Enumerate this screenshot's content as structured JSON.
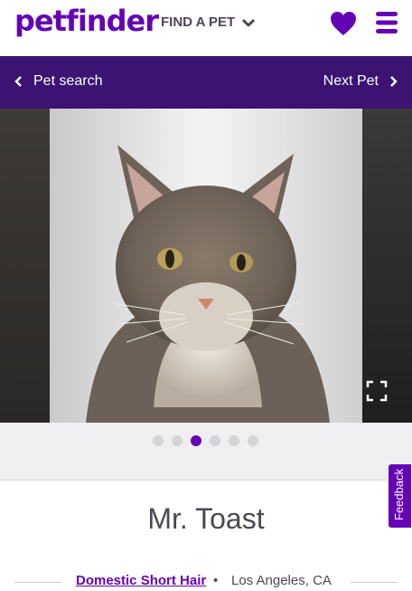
{
  "header": {
    "logo_text": "petfinder",
    "find_a_pet_label": "FIND A PET",
    "brand_color": "#6504b5",
    "icons": {
      "dropdown": "chevron-down-icon",
      "favorites": "heart-icon",
      "menu": "hamburger-menu-icon"
    }
  },
  "nav": {
    "back_label": "Pet search",
    "next_label": "Next Pet",
    "background": "#3a1373"
  },
  "gallery": {
    "total_images": 6,
    "active_index": 3,
    "expand_icon": "fullscreen-icon"
  },
  "pet": {
    "name": "Mr. Toast",
    "breed": "Domestic Short Hair",
    "separator": "•",
    "location": "Los Angeles, CA"
  },
  "feedback_tab": {
    "label": "Feedback"
  }
}
